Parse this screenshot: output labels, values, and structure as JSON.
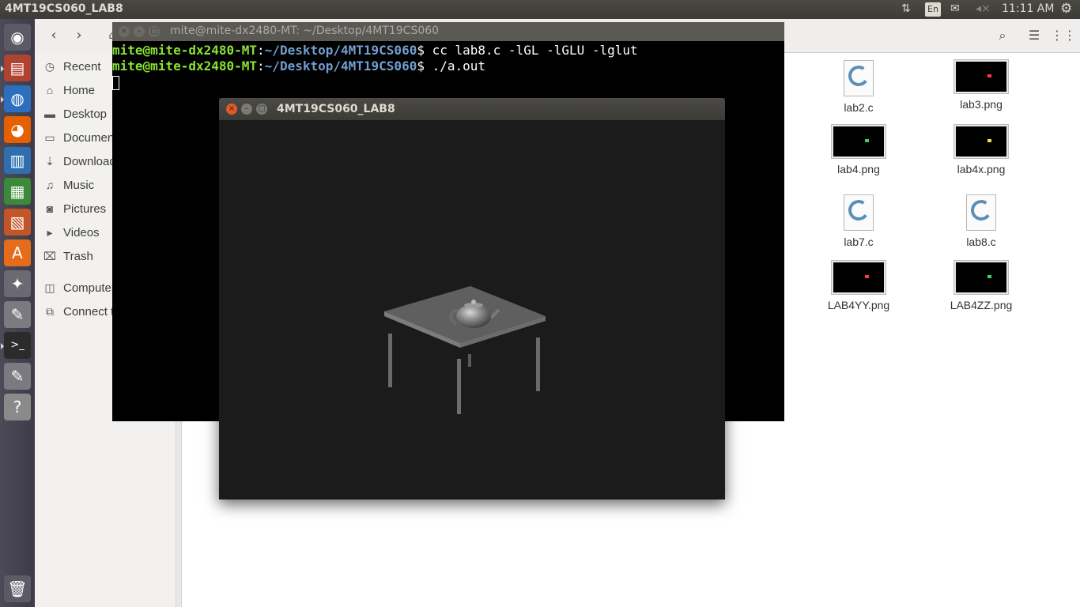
{
  "top_panel": {
    "title": "4MT19CS060_LAB8",
    "keyboard": "En",
    "clock": "11:11 AM",
    "icons": [
      "transfer-arrows-icon",
      "mail-icon",
      "volume-muted-icon",
      "system-gear-icon"
    ]
  },
  "launcher": {
    "items": [
      {
        "name": "dash-home",
        "glyph": "◉",
        "color": "#5c5a66"
      },
      {
        "name": "files",
        "glyph": "▤",
        "color": "#b0432f"
      },
      {
        "name": "chromium",
        "glyph": "◍",
        "color": "#2c6fbf"
      },
      {
        "name": "firefox",
        "glyph": "◕",
        "color": "#e66000"
      },
      {
        "name": "libreoffice-writer",
        "glyph": "▥",
        "color": "#2f6fb0"
      },
      {
        "name": "libreoffice-calc",
        "glyph": "▦",
        "color": "#3a8a3a"
      },
      {
        "name": "libreoffice-impress",
        "glyph": "▧",
        "color": "#c2562a"
      },
      {
        "name": "software-center",
        "glyph": "A",
        "color": "#e46c1b"
      },
      {
        "name": "system-settings",
        "glyph": "✦",
        "color": "#6a6a72"
      },
      {
        "name": "text-editor",
        "glyph": "✎",
        "color": "#7a7a80"
      },
      {
        "name": "terminal",
        "glyph": ">_",
        "color": "#2b2b2b"
      },
      {
        "name": "text-editor-2",
        "glyph": "✎",
        "color": "#7a7a80"
      },
      {
        "name": "help",
        "glyph": "?",
        "color": "#8a8a8a"
      },
      {
        "name": "trash",
        "glyph": "🗑",
        "color": "#5c5a66"
      }
    ]
  },
  "sidebar": {
    "items": [
      {
        "label": "Recent",
        "icon": "◷"
      },
      {
        "label": "Home",
        "icon": "⌂"
      },
      {
        "label": "Desktop",
        "icon": "▬"
      },
      {
        "label": "Documents",
        "icon": "▭"
      },
      {
        "label": "Downloads",
        "icon": "⇣"
      },
      {
        "label": "Music",
        "icon": "♫"
      },
      {
        "label": "Pictures",
        "icon": "◙"
      },
      {
        "label": "Videos",
        "icon": "▸"
      },
      {
        "label": "Trash",
        "icon": "⌧"
      },
      {
        "label": "Computer",
        "icon": "◫"
      },
      {
        "label": "Connect to Server",
        "icon": "⧉"
      }
    ]
  },
  "files": [
    {
      "name": "lab2.c",
      "type": "c"
    },
    {
      "name": "lab3.png",
      "type": "png"
    },
    {
      "name": "lab4.png",
      "type": "png"
    },
    {
      "name": "lab4x.png",
      "type": "png"
    },
    {
      "name": "lab7.c",
      "type": "c"
    },
    {
      "name": "lab8.c",
      "type": "c"
    },
    {
      "name": "LAB4YY.png",
      "type": "png"
    },
    {
      "name": "LAB4ZZ.png",
      "type": "png"
    }
  ],
  "terminal": {
    "title": "mite@mite-dx2480-MT: ~/Desktop/4MT19CS060",
    "lines": [
      {
        "user": "mite@mite-dx2480-MT",
        "path": "~/Desktop/4MT19CS060",
        "cmd": "cc lab8.c -lGL -lGLU -lglut"
      },
      {
        "user": "mite@mite-dx2480-MT",
        "path": "~/Desktop/4MT19CS060",
        "cmd": "./a.out"
      }
    ]
  },
  "gl_window": {
    "title": "4MT19CS060_LAB8",
    "scene": "table-with-teapot"
  }
}
